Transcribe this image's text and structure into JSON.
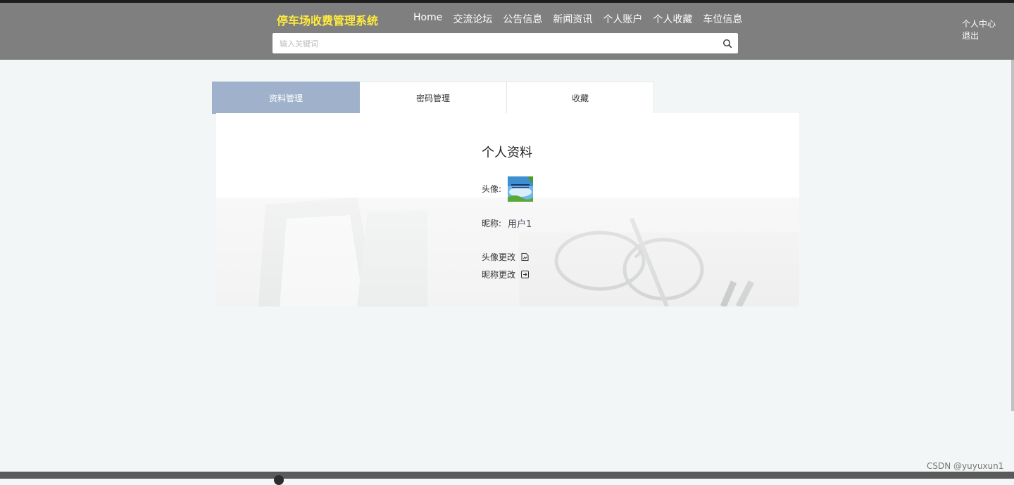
{
  "header": {
    "brand": "停车场收费管理系统",
    "nav": [
      "Home",
      "交流论坛",
      "公告信息",
      "新闻资讯",
      "个人账户",
      "个人收藏",
      "车位信息"
    ],
    "search_placeholder": "输入关键词",
    "user_center": "个人中心",
    "logout": "退出"
  },
  "tabs": [
    {
      "label": "资料管理",
      "active": true
    },
    {
      "label": "密码管理",
      "active": false
    },
    {
      "label": "收藏",
      "active": false
    }
  ],
  "profile": {
    "title": "个人资料",
    "avatar_label": "头像:",
    "nickname_label": "昵称:",
    "nickname_value": "用户1",
    "change_avatar": "头像更改",
    "change_nickname": "昵称更改"
  },
  "footer": {
    "watermark": "CSDN @yuyuxun1"
  },
  "colors": {
    "header_bg": "#7f7f7f",
    "brand": "#ffeb3b",
    "tab_active": "#a0b2cb",
    "page_bg": "#f3f6f6"
  }
}
